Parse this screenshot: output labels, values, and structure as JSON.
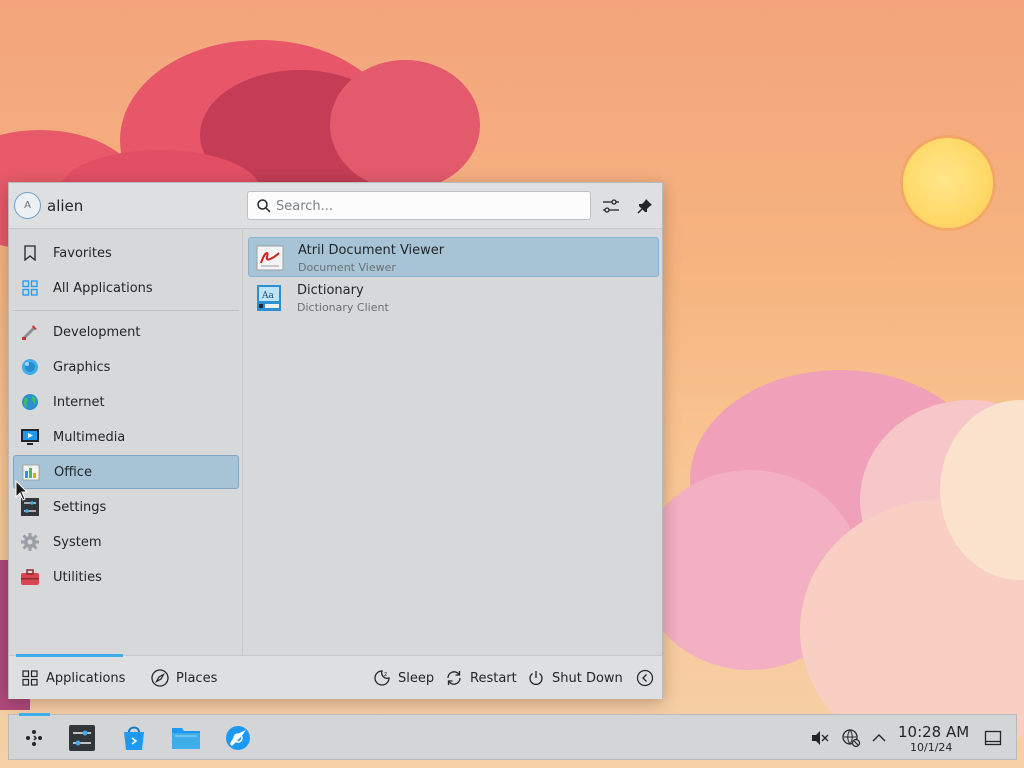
{
  "colors": {
    "accent": "#3daee9",
    "selection": "#a7c3d6",
    "panel": "#d7d8d9"
  },
  "launcher": {
    "avatar_letter": "A",
    "username": "alien",
    "search": {
      "placeholder": "Search...",
      "value": ""
    },
    "sidebar": {
      "items": [
        {
          "label": "Favorites",
          "icon": "bookmark-icon"
        },
        {
          "label": "All Applications",
          "icon": "grid-icon"
        },
        {
          "label": "Development",
          "icon": "development-icon"
        },
        {
          "label": "Graphics",
          "icon": "graphics-icon"
        },
        {
          "label": "Internet",
          "icon": "internet-icon"
        },
        {
          "label": "Multimedia",
          "icon": "multimedia-icon"
        },
        {
          "label": "Office",
          "icon": "office-icon",
          "selected": true
        },
        {
          "label": "Settings",
          "icon": "settings-icon"
        },
        {
          "label": "System",
          "icon": "system-icon"
        },
        {
          "label": "Utilities",
          "icon": "utilities-icon"
        }
      ]
    },
    "apps": [
      {
        "name": "Atril Document Viewer",
        "description": "Document Viewer",
        "icon": "pdf-viewer-icon"
      },
      {
        "name": "Dictionary",
        "description": "Dictionary Client",
        "icon": "dictionary-icon"
      }
    ],
    "footer": {
      "applications": "Applications",
      "places": "Places",
      "sleep": "Sleep",
      "restart": "Restart",
      "shutdown": "Shut Down"
    }
  },
  "taskbar": {
    "clock": {
      "time": "10:28 AM",
      "date": "10/1/24"
    }
  }
}
